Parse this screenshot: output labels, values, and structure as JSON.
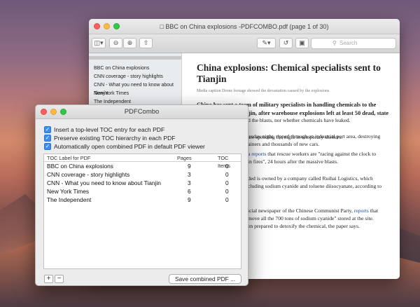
{
  "preview": {
    "title": "BBC on China explosions -PDFCOMBO.pdf (page 1 of 30)",
    "search_placeholder": "Search",
    "sidebar": [
      "BBC on China explosions",
      "CNN coverage - story highlights",
      "CNN - What you need to know about Tianjin",
      "New York Times",
      "The Independent"
    ],
    "article": {
      "headline": "China explosions: Chemical specialists sent to Tianjin",
      "caption": "Media caption Drone footage showed the devastation caused by the explosions",
      "lead": "China has sent a team of military specialists in handling chemicals to the northern city of Tianjin, after warehouse explosions left at least 50 dead, state media report.",
      "p1": "The blasts, late on Wednesday night, ripped through an industrial port area, destroying buildings, shipping containers and thousands of new cars.",
      "p2": "d the blasts, nor whether chemicals have leaked.",
      "p3": "are spending the night in temporary shelters.",
      "p4_link": "a reports",
      "p4_rest": " that rescue workers are \"racing against the clock to",
      "p4b": "in fires\", 24 hours after the massive blasts.",
      "p5": "ded is owned by a company called Ruihai Logistics, which",
      "p5b": "cluding sodium cyanide and toluene diisocyanate, according to",
      "p6a": "icial newspaper of the Chinese Communist Party, ",
      "p6_link": "reports",
      "p6b": " that",
      "p6c": "move all the 700 tons of sodium cyanide\" stored at the site.",
      "p6d": "en prepared to detoxify the chemical, the paper says."
    }
  },
  "dialog": {
    "title": "PDFCombo",
    "options": [
      "Insert a top-level TOC entry for each PDF",
      "Preserve existing TOC hierarchy in each PDF",
      "Automatically open combined PDF in default PDF viewer"
    ],
    "columns": {
      "label": "TOC Label for PDF",
      "pages": "Pages",
      "toc": "TOC Items"
    },
    "rows": [
      {
        "label": "BBC on China explosions",
        "pages": "9",
        "toc": "0"
      },
      {
        "label": "CNN coverage - story highlights",
        "pages": "3",
        "toc": "0"
      },
      {
        "label": "CNN - What you need to know about Tianjin",
        "pages": "3",
        "toc": "0"
      },
      {
        "label": "New York Times",
        "pages": "6",
        "toc": "0"
      },
      {
        "label": "The Independent",
        "pages": "9",
        "toc": "0"
      }
    ],
    "add_label": "+",
    "remove_label": "−",
    "save_label": "Save combined PDF ..."
  },
  "colors": {
    "accent": "#3a8ef2",
    "link": "#1a4a9a"
  }
}
